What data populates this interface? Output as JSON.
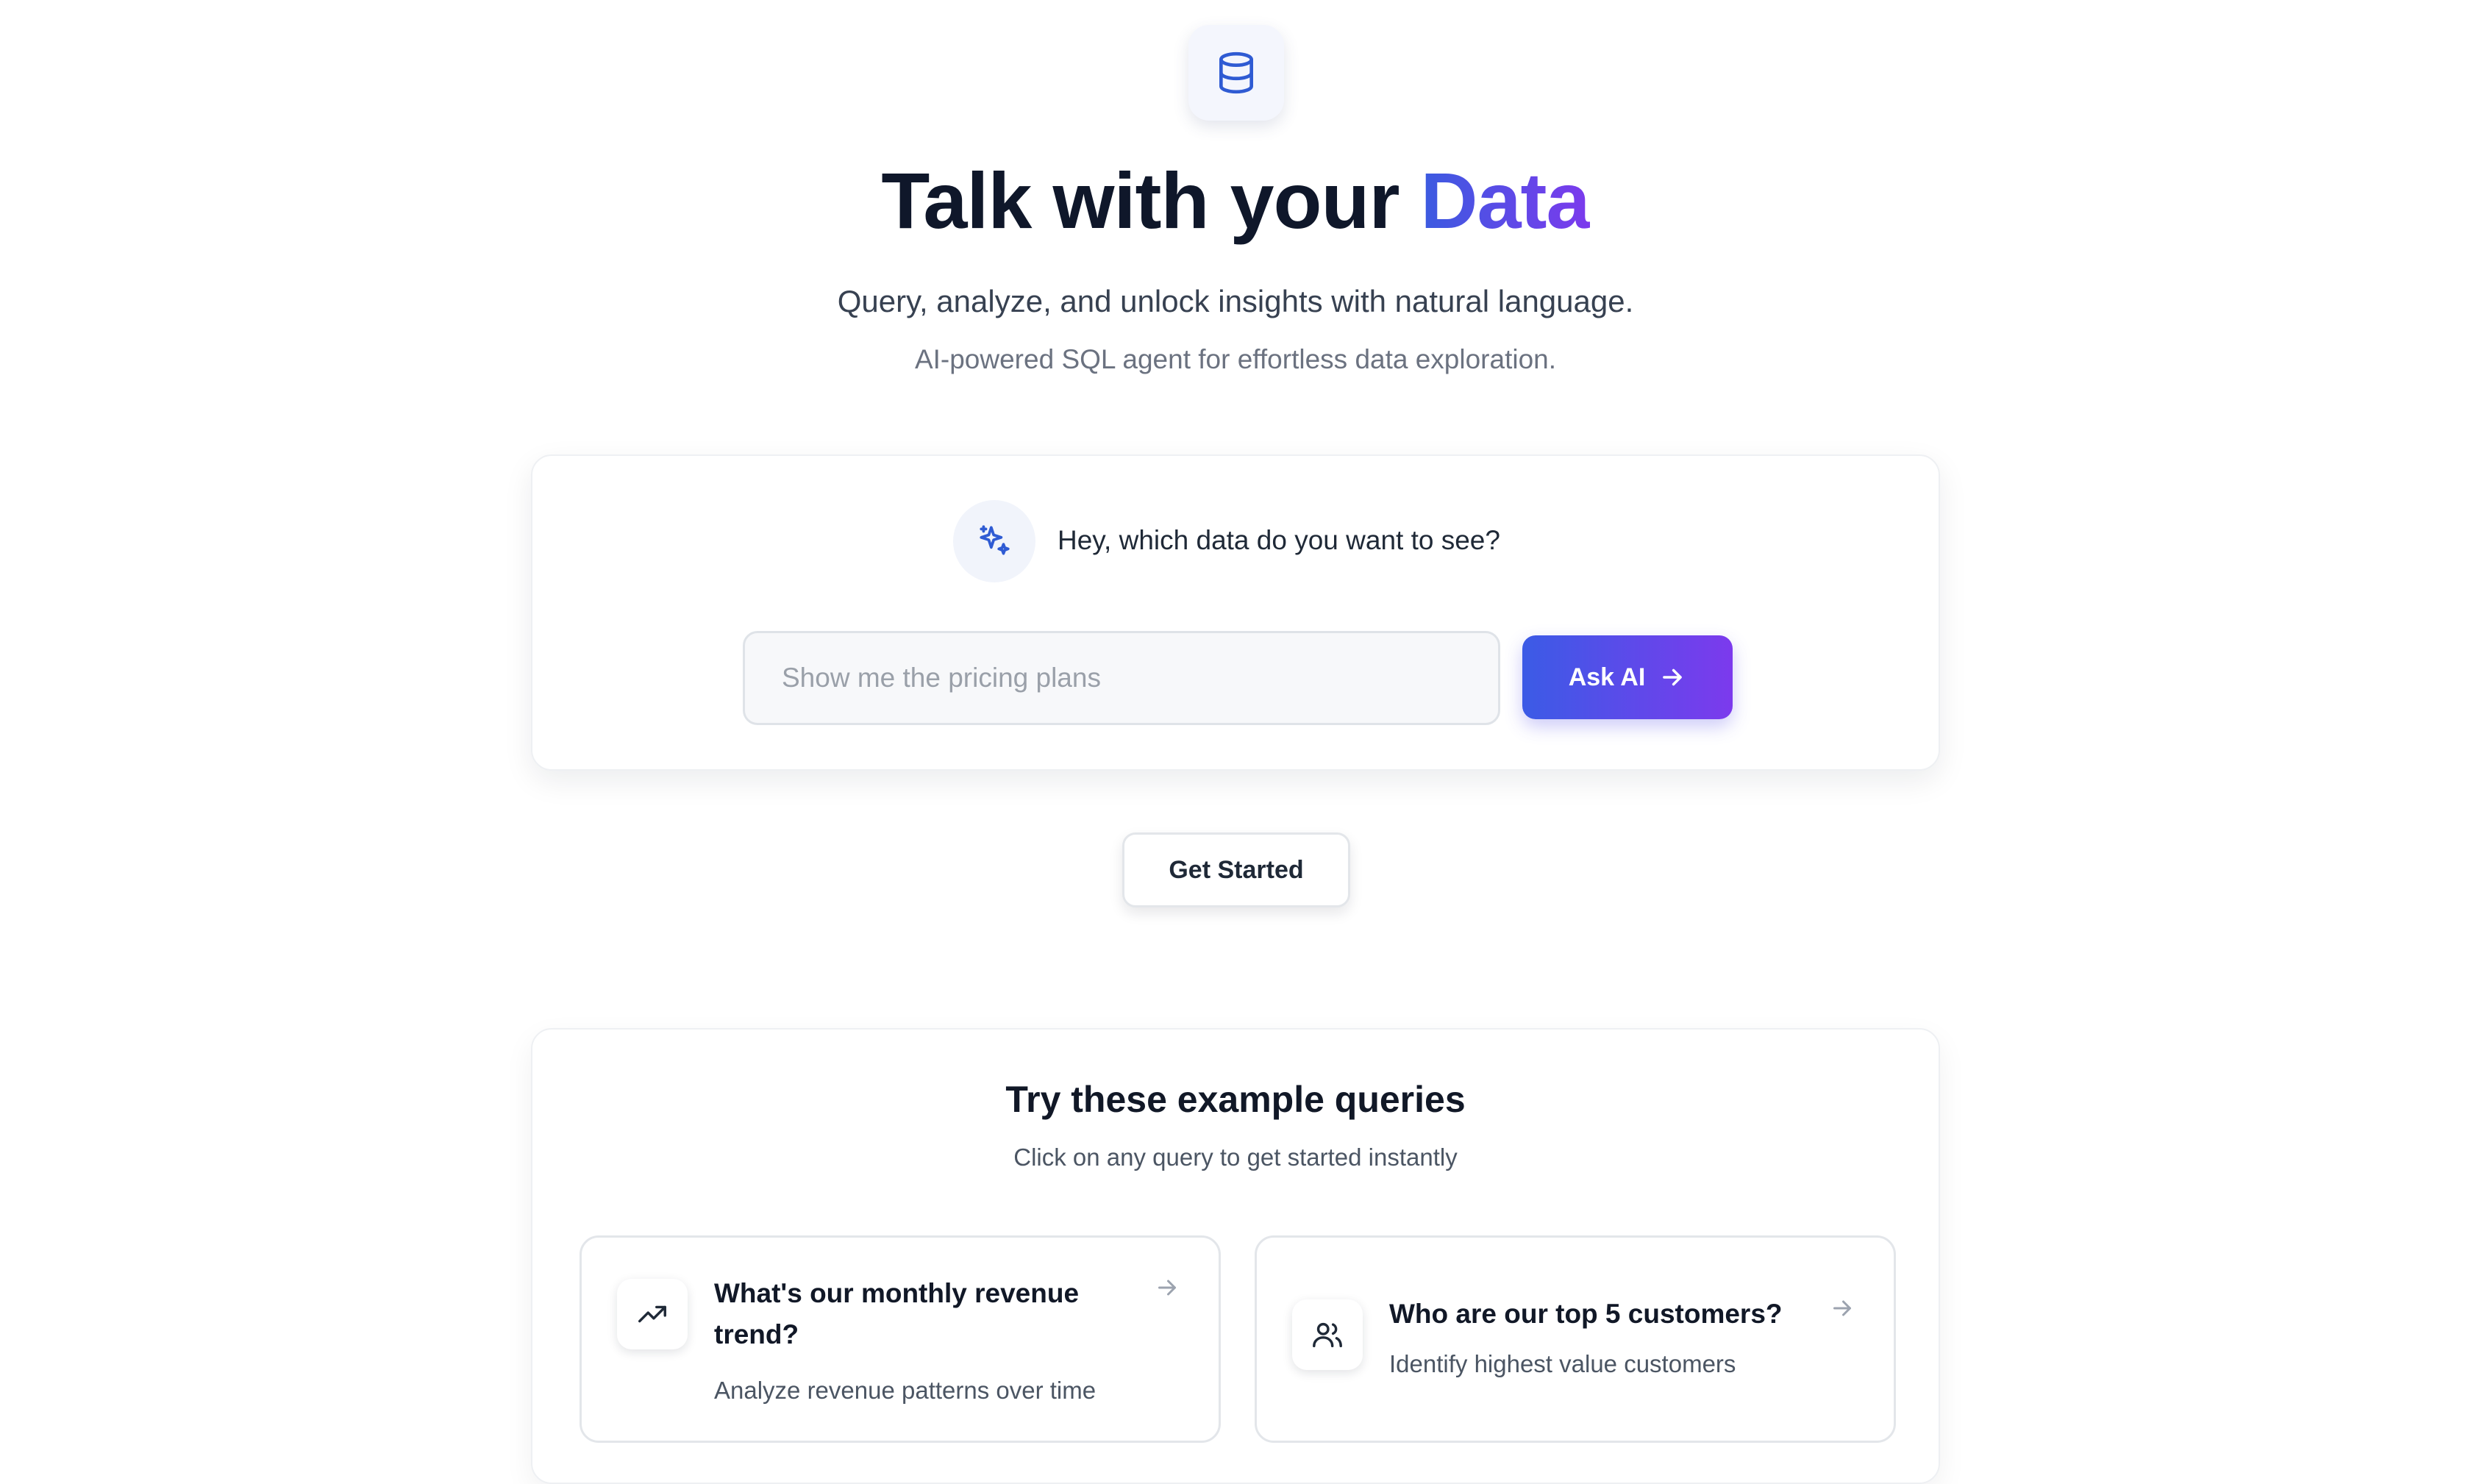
{
  "hero": {
    "logo_icon": "database-icon",
    "headline_prefix": "Talk with your ",
    "headline_highlight": "Data",
    "subtitle": "Query, analyze, and unlock insights with natural language.",
    "tagline": "AI-powered SQL agent for effortless data exploration."
  },
  "ask_card": {
    "icon": "sparkles-icon",
    "prompt": "Hey, which data do you want to see?",
    "input_value": "",
    "input_placeholder": "Show me the pricing plans",
    "button_label": "Ask AI",
    "button_icon": "arrow-right-icon"
  },
  "get_started_label": "Get Started",
  "examples": {
    "title": "Try these example queries",
    "subtitle": "Click on any query to get started instantly",
    "items": [
      {
        "icon": "trending-up-icon",
        "title": "What's our monthly revenue trend?",
        "description": "Analyze revenue patterns over time"
      },
      {
        "icon": "users-icon",
        "title": "Who are our top 5 customers?",
        "description": "Identify highest value customers"
      }
    ]
  },
  "colors": {
    "accent_start": "#3b5be6",
    "accent_end": "#7c3aed",
    "icon_blue": "#2f5bd3",
    "text_dark": "#0f172a"
  }
}
